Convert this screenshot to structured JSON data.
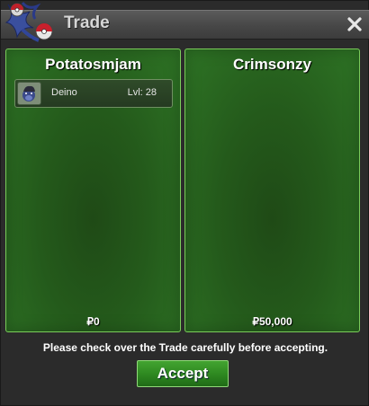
{
  "window": {
    "title": "Trade",
    "close_icon": "close-icon",
    "logo_icon": "pokeball-logo-icon"
  },
  "trade": {
    "left": {
      "player_name": "Potatosmjam",
      "items": [
        {
          "icon": "deino-pokemon-icon",
          "name": "Deino",
          "level": "Lvl: 28"
        }
      ],
      "money": "₽0"
    },
    "right": {
      "player_name": "Crimsonzy",
      "items": [],
      "money": "₽50,000"
    }
  },
  "footer": {
    "notice": "Please check over the Trade carefully before accepting.",
    "accept_label": "Accept"
  },
  "colors": {
    "panel_border": "#7acc5a",
    "accept_button": "#2f8a21"
  }
}
